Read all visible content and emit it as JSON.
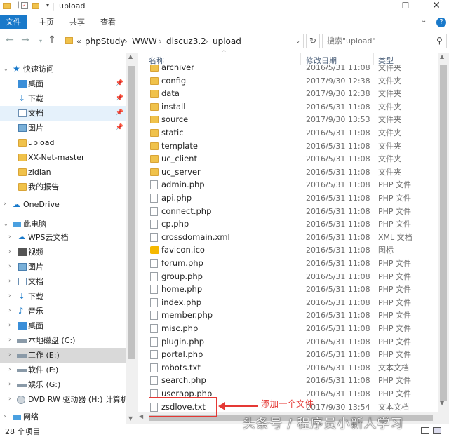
{
  "window": {
    "title": "upload"
  },
  "ribbon": {
    "file": "文件",
    "tabs": [
      "主页",
      "共享",
      "查看"
    ]
  },
  "address": {
    "prefix": "«",
    "crumbs": [
      "phpStudy",
      "WWW",
      "discuz3.2",
      "upload"
    ],
    "sep": "›"
  },
  "search": {
    "placeholder": "搜索\"upload\""
  },
  "nav": {
    "quick_access": "快速访问",
    "pinned": [
      "桌面",
      "下载",
      "文档",
      "图片"
    ],
    "folders": [
      "upload",
      "XX-Net-master",
      "zidian",
      "我的报告"
    ],
    "onedrive": "OneDrive",
    "this_pc": "此电脑",
    "pc_items": [
      "WPS云文档",
      "视频",
      "图片",
      "文档",
      "下载",
      "音乐",
      "桌面",
      "本地磁盘 (C:)",
      "工作 (E:)",
      "软件 (F:)",
      "娱乐 (G:)",
      "DVD RW 驱动器 (H:) 计算机组"
    ],
    "network": "网络"
  },
  "columns": {
    "name": "名称",
    "date": "修改日期",
    "type": "类型"
  },
  "files": [
    {
      "name": "archiver",
      "date": "2016/5/31 11:08",
      "type": "文件夹",
      "icon": "folder"
    },
    {
      "name": "config",
      "date": "2017/9/30 12:38",
      "type": "文件夹",
      "icon": "folder"
    },
    {
      "name": "data",
      "date": "2017/9/30 12:38",
      "type": "文件夹",
      "icon": "folder"
    },
    {
      "name": "install",
      "date": "2016/5/31 11:08",
      "type": "文件夹",
      "icon": "folder"
    },
    {
      "name": "source",
      "date": "2017/9/30 13:53",
      "type": "文件夹",
      "icon": "folder"
    },
    {
      "name": "static",
      "date": "2016/5/31 11:08",
      "type": "文件夹",
      "icon": "folder"
    },
    {
      "name": "template",
      "date": "2016/5/31 11:08",
      "type": "文件夹",
      "icon": "folder"
    },
    {
      "name": "uc_client",
      "date": "2016/5/31 11:08",
      "type": "文件夹",
      "icon": "folder"
    },
    {
      "name": "uc_server",
      "date": "2016/5/31 11:08",
      "type": "文件夹",
      "icon": "folder"
    },
    {
      "name": "admin.php",
      "date": "2016/5/31 11:08",
      "type": "PHP 文件",
      "icon": "doc"
    },
    {
      "name": "api.php",
      "date": "2016/5/31 11:08",
      "type": "PHP 文件",
      "icon": "doc"
    },
    {
      "name": "connect.php",
      "date": "2016/5/31 11:08",
      "type": "PHP 文件",
      "icon": "doc"
    },
    {
      "name": "cp.php",
      "date": "2016/5/31 11:08",
      "type": "PHP 文件",
      "icon": "doc"
    },
    {
      "name": "crossdomain.xml",
      "date": "2016/5/31 11:08",
      "type": "XML 文档",
      "icon": "doc"
    },
    {
      "name": "favicon.ico",
      "date": "2016/5/31 11:08",
      "type": "图标",
      "icon": "fav"
    },
    {
      "name": "forum.php",
      "date": "2016/5/31 11:08",
      "type": "PHP 文件",
      "icon": "doc"
    },
    {
      "name": "group.php",
      "date": "2016/5/31 11:08",
      "type": "PHP 文件",
      "icon": "doc"
    },
    {
      "name": "home.php",
      "date": "2016/5/31 11:08",
      "type": "PHP 文件",
      "icon": "doc"
    },
    {
      "name": "index.php",
      "date": "2016/5/31 11:08",
      "type": "PHP 文件",
      "icon": "doc"
    },
    {
      "name": "member.php",
      "date": "2016/5/31 11:08",
      "type": "PHP 文件",
      "icon": "doc"
    },
    {
      "name": "misc.php",
      "date": "2016/5/31 11:08",
      "type": "PHP 文件",
      "icon": "doc"
    },
    {
      "name": "plugin.php",
      "date": "2016/5/31 11:08",
      "type": "PHP 文件",
      "icon": "doc"
    },
    {
      "name": "portal.php",
      "date": "2016/5/31 11:08",
      "type": "PHP 文件",
      "icon": "doc"
    },
    {
      "name": "robots.txt",
      "date": "2016/5/31 11:08",
      "type": "文本文档",
      "icon": "doc"
    },
    {
      "name": "search.php",
      "date": "2016/5/31 11:08",
      "type": "PHP 文件",
      "icon": "doc"
    },
    {
      "name": "userapp.php",
      "date": "2016/5/31 11:08",
      "type": "PHP 文件",
      "icon": "doc"
    },
    {
      "name": "zsdlove.txt",
      "date": "2017/9/30 13:54",
      "type": "文本文档",
      "icon": "doc"
    }
  ],
  "status": {
    "count": "28 个项目"
  },
  "annotation": {
    "text": "添加一个文件"
  },
  "watermark": "头条号 / 程序员小新人学习"
}
